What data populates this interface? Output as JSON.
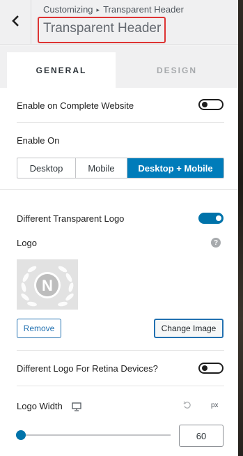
{
  "header": {
    "breadcrumb_parent": "Customizing",
    "breadcrumb_separator": "▸",
    "breadcrumb_current": "Transparent Header",
    "title": "Transparent Header",
    "back_icon": "chevron-left-icon"
  },
  "tabs": [
    {
      "label": "GENERAL",
      "active": true
    },
    {
      "label": "DESIGN",
      "active": false
    }
  ],
  "enable_complete": {
    "label": "Enable on Complete Website",
    "checked": false
  },
  "enable_on": {
    "label": "Enable On",
    "options": [
      "Desktop",
      "Mobile",
      "Desktop + Mobile"
    ],
    "selected": "Desktop + Mobile"
  },
  "different_logo": {
    "label": "Different Transparent Logo",
    "checked": true
  },
  "logo": {
    "label": "Logo",
    "help_icon": "question-icon",
    "help_glyph": "?",
    "image_letter": "N",
    "remove_label": "Remove",
    "change_label": "Change Image"
  },
  "retina_logo": {
    "label": "Different Logo For Retina Devices?",
    "checked": false
  },
  "logo_width": {
    "label": "Logo Width",
    "device_icon": "desktop-icon",
    "reset_icon": "reset-icon",
    "unit": "px",
    "value": "60",
    "slider_fraction": 0.0
  },
  "colors": {
    "accent": "#0073aa",
    "highlight": "#dd3333"
  }
}
